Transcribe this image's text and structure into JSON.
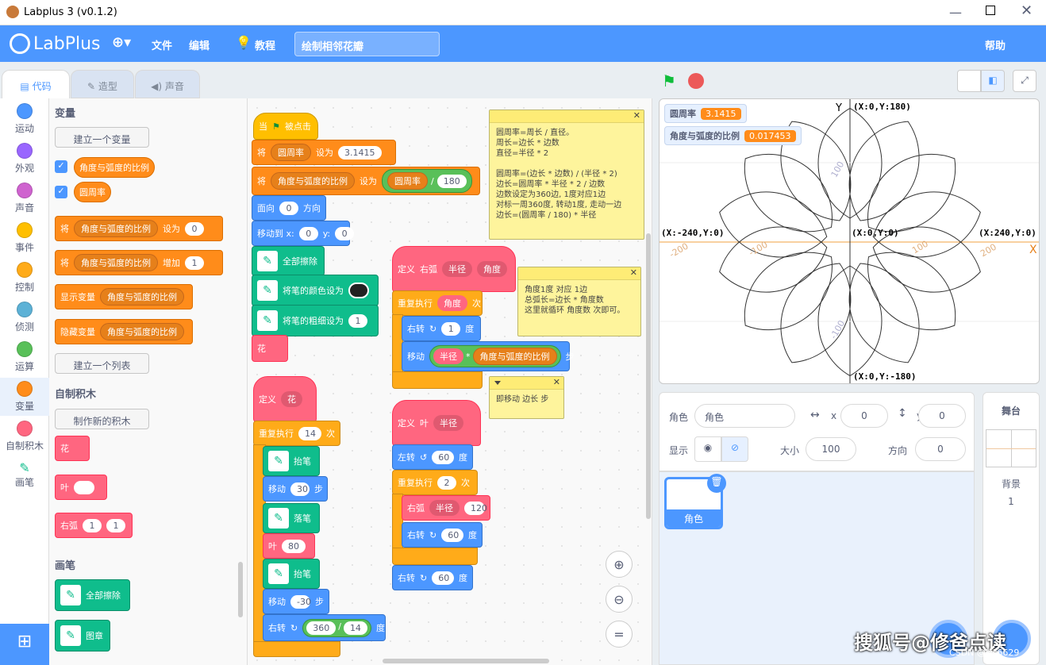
{
  "window": {
    "title": "Labplus 3 (v0.1.2)"
  },
  "menu": {
    "logo": "LabPlus",
    "file": "文件",
    "edit": "编辑",
    "tutorial": "教程",
    "project_title": "绘制相邻花瓣",
    "help": "帮助"
  },
  "tabs": {
    "code": "代码",
    "costume": "造型",
    "sound": "声音"
  },
  "categories": [
    {
      "label": "运动",
      "color": "#4c97ff"
    },
    {
      "label": "外观",
      "color": "#9966ff"
    },
    {
      "label": "声音",
      "color": "#cf63cf"
    },
    {
      "label": "事件",
      "color": "#ffbf00"
    },
    {
      "label": "控制",
      "color": "#ffab19"
    },
    {
      "label": "侦测",
      "color": "#5cb1d6"
    },
    {
      "label": "运算",
      "color": "#59c059"
    },
    {
      "label": "变量",
      "color": "#ff8c1a"
    },
    {
      "label": "自制积木",
      "color": "#ff6680"
    },
    {
      "label": "画笔",
      "color": "#0fbd8c"
    }
  ],
  "palette": {
    "variables_title": "变量",
    "make_variable": "建立一个变量",
    "var1": "角度与弧度的比例",
    "var2": "圆周率",
    "set_label": "将",
    "set_to": "设为",
    "set_val": "0",
    "change_label": "将",
    "change_by": "增加",
    "change_val": "1",
    "show_var": "显示变量",
    "hide_var": "隐藏变量",
    "make_list": "建立一个列表",
    "myblocks_title": "自制积木",
    "make_block": "制作新的积木",
    "blk_flower": "花",
    "blk_leaf": "叶",
    "blk_arc": "右弧",
    "arc_a": "1",
    "arc_b": "1",
    "pen_title": "画笔",
    "pen_clear": "全部擦除",
    "pen_stamp": "图章"
  },
  "script_main": {
    "hat": "当",
    "hat2": "被点击",
    "set1_a": "将",
    "set1_var": "圆周率",
    "set1_b": "设为",
    "set1_val": "3.1415",
    "set2_a": "将",
    "set2_var": "角度与弧度的比例",
    "set2_b": "设为",
    "set2_op1": "圆周率",
    "set2_div": "/",
    "set2_op2": "180",
    "point": "面向",
    "point_val": "0",
    "point_dir": "方向",
    "goto": "移动到 x:",
    "goto_x": "0",
    "goto_y_lbl": "y:",
    "goto_y": "0",
    "clear": "全部擦除",
    "color": "将笔的颜色设为",
    "size": "将笔的粗细设为",
    "size_val": "1",
    "flower": "花"
  },
  "script_flower": {
    "def": "定义",
    "name": "花",
    "repeat": "重复执行",
    "repeat_val": "14",
    "times": "次",
    "penup": "抬笔",
    "move1": "移动",
    "move1_val": "30",
    "steps": "步",
    "pendown": "落笔",
    "leaf": "叶",
    "leaf_val": "80",
    "penup2": "抬笔",
    "move2": "移动",
    "move2_val": "-30",
    "steps2": "步",
    "turn": "右转",
    "turn_a": "360",
    "turn_div": "/",
    "turn_b": "14",
    "deg": "度"
  },
  "script_arc": {
    "def": "定义",
    "name": "右弧",
    "p1": "半径",
    "p2": "角度",
    "repeat": "重复执行",
    "repeat_val": "角度",
    "times": "次",
    "turn": "右转",
    "turn_val": "1",
    "deg": "度",
    "move": "移动",
    "move_a": "半径",
    "mul": "*",
    "move_b": "角度与弧度的比例",
    "steps": "步"
  },
  "script_leaf": {
    "def": "定义",
    "name": "叶",
    "p1": "半径",
    "left": "左转",
    "left_val": "60",
    "deg": "度",
    "repeat": "重复执行",
    "repeat_val": "2",
    "times": "次",
    "arc": "右弧",
    "arc_a": "半径",
    "arc_b": "120",
    "turn": "右转",
    "turn_val": "60",
    "deg2": "度",
    "turn2": "右转",
    "turn2_val": "60",
    "deg3": "度"
  },
  "notes": {
    "n1": "圆周率=周长 / 直径。\n周长=边长 * 边数\n直径=半径 * 2\n\n圆周率=(边长 * 边数) / (半径 * 2)\n边长=圆周率 * 半径 * 2 / 边数\n边数设定为360边, 1度对应1边\n对标一周360度, 转动1度, 走动一边\n边长=(圆周率 / 180) * 半径",
    "n2": "角度1度 对应 1边\n总弧长=边长 * 角度数\n这里就循环 角度数 次即可。",
    "n3": "即移动 边长 步"
  },
  "stage": {
    "mon1_label": "圆周率",
    "mon1_val": "3.1415",
    "mon2_label": "角度与弧度的比例",
    "mon2_val": "0.017453",
    "y_axis": "Y",
    "x_axis": "X",
    "top": "(X:0,Y:180)",
    "bottom": "(X:0,Y:-180)",
    "left": "(X:-240,Y:0)",
    "right": "(X:240,Y:0)",
    "center": "(X:0,Y:0)",
    "t_100": "100",
    "t_m100": "-100",
    "t_200": "200",
    "t_m200": "-200",
    "t_100b": "100",
    "t_m100b": "-100"
  },
  "sprite": {
    "label": "角色",
    "name": "角色",
    "x_lbl": "x",
    "x": "0",
    "y_lbl": "y",
    "y": "0",
    "show": "显示",
    "size_lbl": "大小",
    "size": "100",
    "dir_lbl": "方向",
    "dir": "0",
    "thumb": "角色"
  },
  "stage_panel": {
    "title": "舞台",
    "bg_label": "背景",
    "bg_count": "1"
  },
  "watermark": "搜狐号@修爸点读",
  "credit": "CSDN @lzs6629"
}
